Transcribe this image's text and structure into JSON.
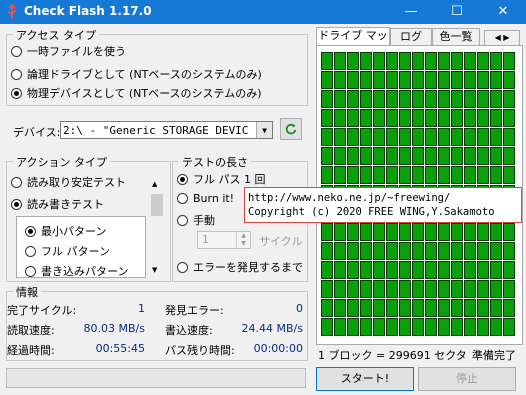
{
  "window": {
    "title": "Check Flash 1.17.0",
    "controls": [
      "—",
      "☐",
      "✕"
    ]
  },
  "access_type": {
    "legend": "アクセス タイプ",
    "options": [
      {
        "label": "一時ファイルを使う",
        "selected": false
      },
      {
        "label": "論理ドライブとして (NTベースのシステムのみ)",
        "selected": false
      },
      {
        "label": "物理デバイスとして (NTベースのシステムのみ)",
        "selected": true
      }
    ]
  },
  "device": {
    "label": "デバイス:",
    "value": "2:\\ - \"Generic STORAGE DEVIC",
    "refresh_icon": "refresh-icon"
  },
  "action_type": {
    "legend": "アクション タイプ",
    "options": [
      {
        "label": "読み取り安定テスト",
        "selected": false
      },
      {
        "label": "読み書きテスト",
        "selected": true
      }
    ],
    "patterns": [
      {
        "label": "最小パターン",
        "selected": true
      },
      {
        "label": "フル パターン",
        "selected": false
      },
      {
        "label": "書き込みパターン",
        "selected": false
      }
    ]
  },
  "test_length": {
    "legend": "テストの長さ",
    "options": [
      {
        "label": "フル パス 1 回",
        "selected": true
      },
      {
        "label": "Burn it!",
        "selected": false
      },
      {
        "label": "手動",
        "selected": false
      },
      {
        "label": "エラーを発見するまで",
        "selected": false
      }
    ],
    "spin_value": "1",
    "spin_unit": "サイクル"
  },
  "tooltip": {
    "line1": "http://www.neko.ne.jp/~freewing/",
    "line2": "Copyright (c) 2020 FREE WING,Y.Sakamoto"
  },
  "info": {
    "legend": "情報",
    "rows": [
      {
        "l1": "完了サイクル:",
        "v1": "1",
        "l2": "発見エラー:",
        "v2": "0"
      },
      {
        "l1": "読取速度:",
        "v1": "80.03 MB/s",
        "l2": "書込速度:",
        "v2": "24.44 MB/s"
      },
      {
        "l1": "経過時間:",
        "v1": "00:55:45",
        "l2": "パス残り時間:",
        "v2": "00:00:00"
      }
    ]
  },
  "tabs": [
    "ドライブ マップ",
    "ログ",
    "色一覧"
  ],
  "map_status": {
    "block_info": "1 ブロック = 299691 セクタ",
    "state": "準備完了"
  },
  "buttons": {
    "start": "スタート!",
    "stop": "停止"
  }
}
